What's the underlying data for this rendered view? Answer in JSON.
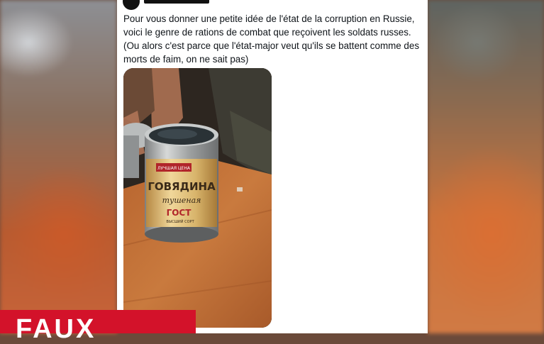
{
  "tweet": {
    "text_lines": [
      "Pour vous donner une petite idée de l'état de la corruption en Russie,",
      "voici le genre de rations de combat que reçoivent les soldats russes.",
      "(Ou alors c'est parce que l'état-major veut qu'ils se battent comme des",
      "morts de faim, on ne sait pas)"
    ]
  },
  "can_label": {
    "banner": "ЛУЧШАЯ ЦЕНА",
    "main": "ГОВЯДИНА",
    "sub": "тушеная",
    "standard": "ГОСТ",
    "grade": "ВЫСШИЙ СОРТ"
  },
  "verdict": {
    "label": "FAUX",
    "color": "#d3122a"
  }
}
